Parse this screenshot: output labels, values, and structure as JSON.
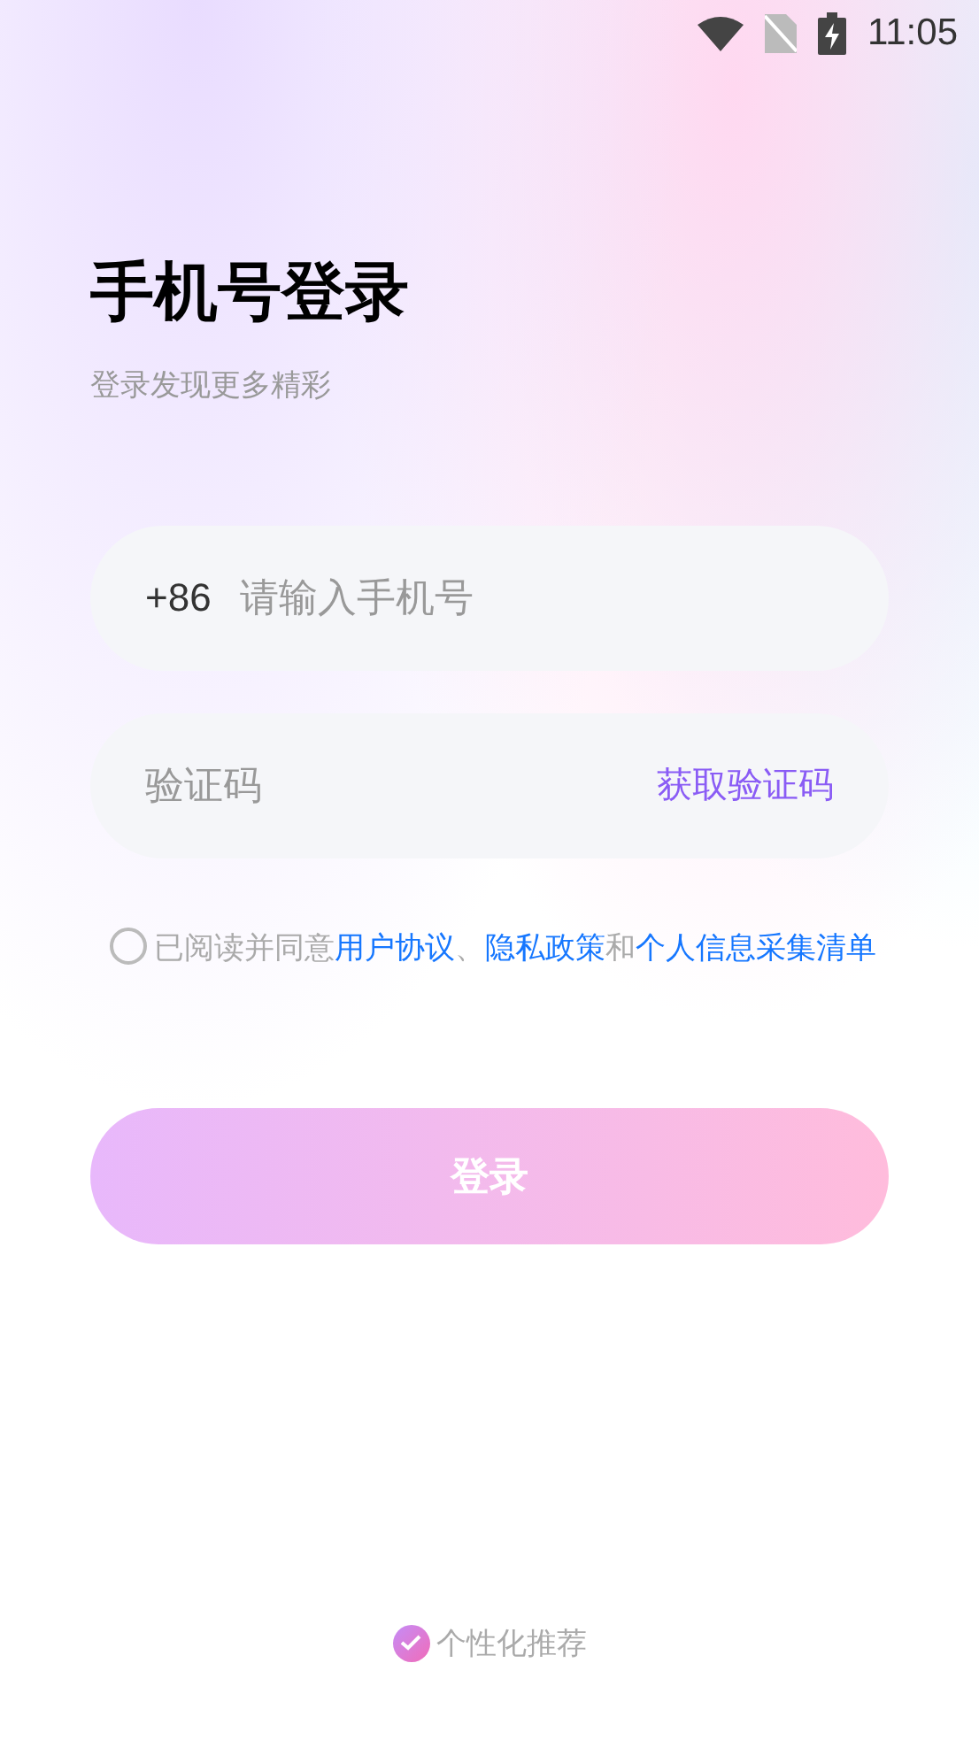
{
  "status_bar": {
    "time": "11:05"
  },
  "header": {
    "title": "手机号登录",
    "subtitle": "登录发现更多精彩"
  },
  "phone_field": {
    "prefix": "+86",
    "placeholder": "请输入手机号"
  },
  "code_field": {
    "placeholder": "验证码",
    "action": "获取验证码"
  },
  "agreement": {
    "checked": false,
    "segments": [
      {
        "kind": "text",
        "text": "已阅读并同意"
      },
      {
        "kind": "link",
        "text": "用户协议"
      },
      {
        "kind": "text",
        "text": "、"
      },
      {
        "kind": "link",
        "text": "隐私政策"
      },
      {
        "kind": "text",
        "text": "和"
      },
      {
        "kind": "link",
        "text": "个人信息采集清单"
      }
    ]
  },
  "login_button": {
    "label": "登录",
    "disabled": true
  },
  "personalized": {
    "label": "个性化推荐",
    "checked": true
  }
}
